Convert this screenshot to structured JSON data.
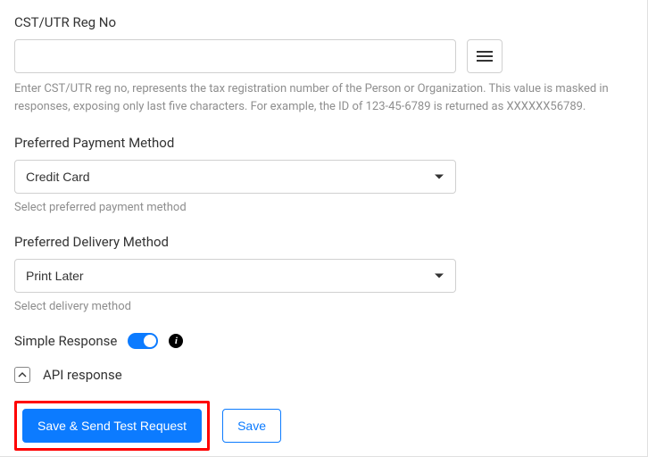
{
  "cst_utr": {
    "label": "CST/UTR Reg No",
    "value": "",
    "help": "Enter CST/UTR reg no, represents the tax registration number of the Person or Organization. This value is masked in responses, exposing only last five characters. For example, the ID of 123-45-6789 is returned as XXXXXX56789."
  },
  "payment_method": {
    "label": "Preferred Payment Method",
    "value": "Credit Card",
    "help": "Select preferred payment method"
  },
  "delivery_method": {
    "label": "Preferred Delivery Method",
    "value": "Print Later",
    "help": "Select delivery method"
  },
  "simple_response": {
    "label": "Simple Response",
    "checked": true
  },
  "api_response": {
    "label": "API response"
  },
  "buttons": {
    "save_send": "Save & Send Test Request",
    "save": "Save"
  }
}
